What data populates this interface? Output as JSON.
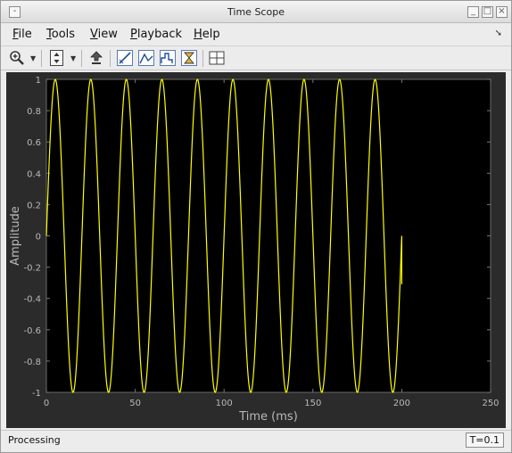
{
  "window": {
    "title": "Time Scope"
  },
  "menu": [
    {
      "label": "File",
      "u": "F",
      "rest": "ile"
    },
    {
      "label": "Tools",
      "u": "T",
      "rest": "ools"
    },
    {
      "label": "View",
      "u": "V",
      "rest": "iew"
    },
    {
      "label": "Playback",
      "u": "P",
      "rest": "layback"
    },
    {
      "label": "Help",
      "u": "H",
      "rest": "elp"
    }
  ],
  "toolbar": {
    "icons": [
      "zoom-in-icon",
      "scale-axes-icon",
      "restore-view-icon",
      "cursor-measurements-icon",
      "peak-finder-icon",
      "signal-statistics-icon",
      "bilevel-measurements-icon",
      "layout-icon"
    ]
  },
  "chart_data": {
    "type": "line",
    "xlabel": "Time (ms)",
    "ylabel": "Amplitude",
    "xlim": [
      0,
      250
    ],
    "ylim": [
      -1,
      1
    ],
    "x_ticks": [
      "0",
      "50",
      "100",
      "150",
      "200",
      "250"
    ],
    "y_ticks": [
      "1",
      "0.8",
      "0.6",
      "0.4",
      "0.2",
      "0",
      "-0.2",
      "-0.4",
      "-0.6",
      "-0.8",
      "-1"
    ],
    "series": [
      {
        "frequency_hz": 50,
        "amplitude": 1,
        "x_range": [
          0,
          200
        ],
        "final_value": -0.31
      }
    ],
    "colors": {
      "background": "#000000",
      "trace": "#ffff00",
      "frame": "#2b2b2b",
      "text": "#b9b9b9"
    }
  },
  "status": {
    "text": "Processing",
    "time": "T=0.1"
  }
}
